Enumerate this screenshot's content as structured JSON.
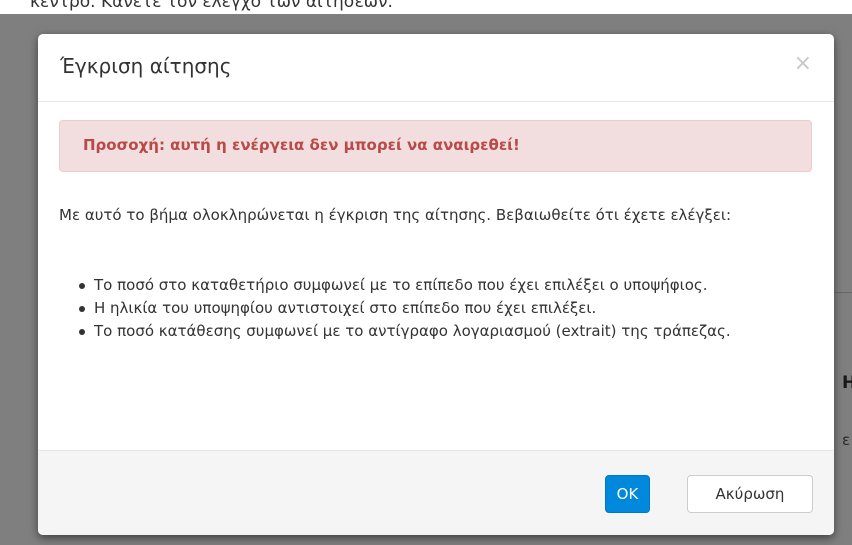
{
  "background": {
    "top_text": "κεντρο. Κάνετε τον έλεγχο των αιτήσεων.",
    "right_bold_fragment": "Η",
    "right_text_fragment": "ε"
  },
  "modal": {
    "title": "Έγκριση αίτησης",
    "close_label": "×",
    "alert": "Προσοχή: αυτή η ενέργεια δεν μπορεί να αναιρεθεί!",
    "intro": "Με αυτό το βήμα ολοκληρώνεται η έγκριση της αίτησης. Βεβαιωθείτε ότι έχετε ελέγξει:",
    "checklist": [
      "Το ποσό στο καταθετήριο συμφωνεί με το επίπεδο που έχει επιλέξει ο υποψήφιος.",
      "Η ηλικία του υποψηφίου αντιστοιχεί στο επίπεδο που έχει επιλέξει.",
      "Το ποσό κατάθεσης συμφωνεί με το αντίγραφο λογαριασμού (extrait) της τράπεζας."
    ],
    "ok_label": "OK",
    "cancel_label": "Ακύρωση"
  },
  "colors": {
    "primary": "#0088dd",
    "alert_bg": "#f2dede",
    "alert_text": "#b94a48",
    "footer_bg": "#f5f5f5"
  }
}
